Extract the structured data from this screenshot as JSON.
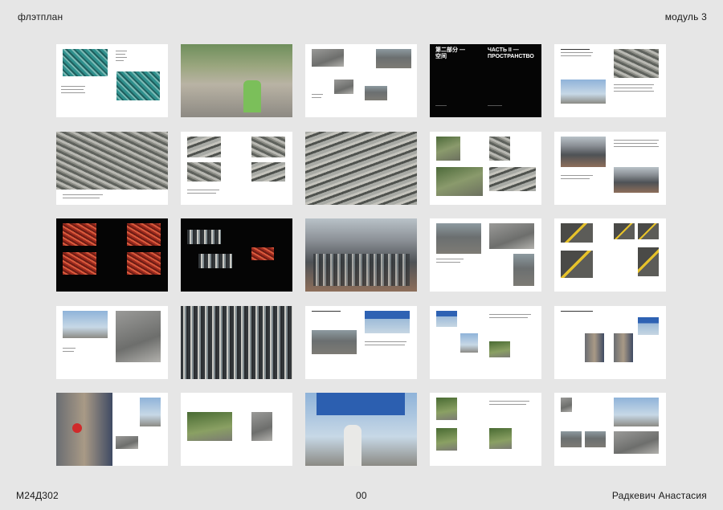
{
  "header": {
    "left": "флэтплан",
    "right": "модуль 3"
  },
  "footer": {
    "left": "М24Д302",
    "center": "00",
    "right": "Радкевич Анастасия"
  },
  "divider_spread": {
    "left_title": "第二部分 —\n空间",
    "right_title": "ЧАСТЬ II —\nПРОСТРАНСТВО"
  },
  "spreads": [
    {
      "id": "01",
      "theme": "bikes-sharing"
    },
    {
      "id": "02",
      "theme": "cyclist-street"
    },
    {
      "id": "03",
      "theme": "street-photos"
    },
    {
      "id": "04",
      "theme": "part-divider",
      "dark": true
    },
    {
      "id": "05",
      "theme": "highways-text"
    },
    {
      "id": "06",
      "theme": "interchange-aerial"
    },
    {
      "id": "07",
      "theme": "interchange-grid"
    },
    {
      "id": "08",
      "theme": "overpass-full"
    },
    {
      "id": "09",
      "theme": "interchange-photos"
    },
    {
      "id": "10",
      "theme": "traffic-text"
    },
    {
      "id": "11",
      "theme": "night-red",
      "dark": true
    },
    {
      "id": "12",
      "theme": "night-cars",
      "dark": true
    },
    {
      "id": "13",
      "theme": "traffic-jam"
    },
    {
      "id": "14",
      "theme": "road-markings"
    },
    {
      "id": "15",
      "theme": "yellow-markings"
    },
    {
      "id": "16",
      "theme": "crossing"
    },
    {
      "id": "17",
      "theme": "bus-traffic"
    },
    {
      "id": "18",
      "theme": "road-signs"
    },
    {
      "id": "19",
      "theme": "signs-photos"
    },
    {
      "id": "20",
      "theme": "signs-text"
    },
    {
      "id": "21",
      "theme": "no-entry-sign"
    },
    {
      "id": "22",
      "theme": "small-photos"
    },
    {
      "id": "23",
      "theme": "tunnel-sign"
    },
    {
      "id": "24",
      "theme": "street-trees"
    },
    {
      "id": "25",
      "theme": "crossing-photos"
    }
  ]
}
